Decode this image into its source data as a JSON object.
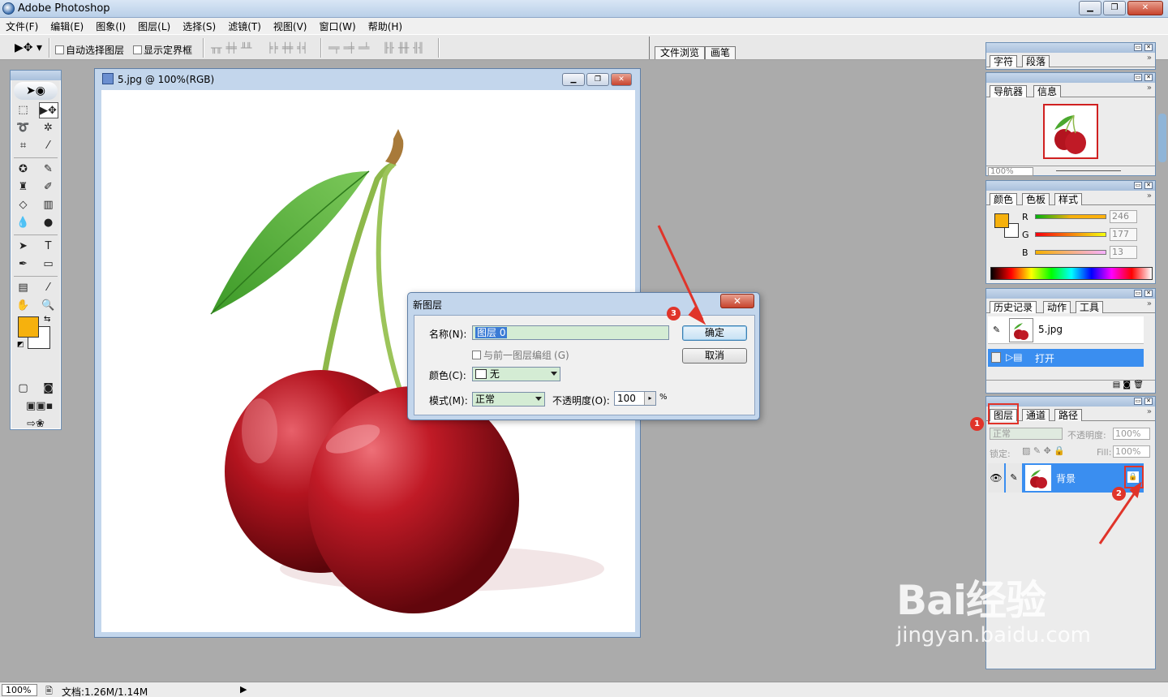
{
  "app": {
    "title": "Adobe Photoshop"
  },
  "menu": [
    "文件(F)",
    "编辑(E)",
    "图象(I)",
    "图层(L)",
    "选择(S)",
    "滤镜(T)",
    "视图(V)",
    "窗口(W)",
    "帮助(H)"
  ],
  "options": {
    "auto_select_label": "自动选择图层",
    "show_bounds_label": "显示定界框",
    "palette_well_tabs": [
      "文件浏览",
      "画笔"
    ]
  },
  "toolbox": {
    "fg_color": "#f6b10d",
    "bg_color": "#ffffff"
  },
  "document": {
    "title": "5.jpg @ 100%(RGB)"
  },
  "dialog": {
    "title": "新图层",
    "name_label": "名称(N):",
    "name_value": "图层 0",
    "group_label": "与前一图层编组",
    "group_shortcut": "(G)",
    "color_label": "颜色(C):",
    "color_value": "无",
    "mode_label": "模式(M):",
    "mode_value": "正常",
    "opacity_label": "不透明度(O):",
    "opacity_value": "100",
    "opacity_unit": "%",
    "ok_label": "确定",
    "cancel_label": "取消"
  },
  "palettes": {
    "char": {
      "tabs": [
        "字符",
        "段落"
      ]
    },
    "navigator": {
      "tabs": [
        "导航器",
        "信息"
      ],
      "zoom": "100%"
    },
    "color": {
      "tabs": [
        "颜色",
        "色板",
        "样式"
      ],
      "channels": [
        {
          "label": "R",
          "value": "246"
        },
        {
          "label": "G",
          "value": "177"
        },
        {
          "label": "B",
          "value": "13"
        }
      ]
    },
    "history": {
      "tabs": [
        "历史记录",
        "动作",
        "工具"
      ],
      "snapshot": "5.jpg",
      "items": [
        "打开"
      ]
    },
    "layers": {
      "tabs": [
        "图层",
        "通道",
        "路径"
      ],
      "blend_mode": "正常",
      "opacity_label": "不透明度:",
      "opacity_value": "100%",
      "lock_label": "锁定:",
      "fill_label": "Fill:",
      "fill_value": "100%",
      "layer_name": "背景"
    }
  },
  "annotations": [
    "1",
    "2",
    "3"
  ],
  "status": {
    "zoom": "100%",
    "doc_info": "文档:1.26M/1.14M"
  },
  "watermark": {
    "brand": "Bai经验",
    "url": "jingyan.baidu.com"
  }
}
